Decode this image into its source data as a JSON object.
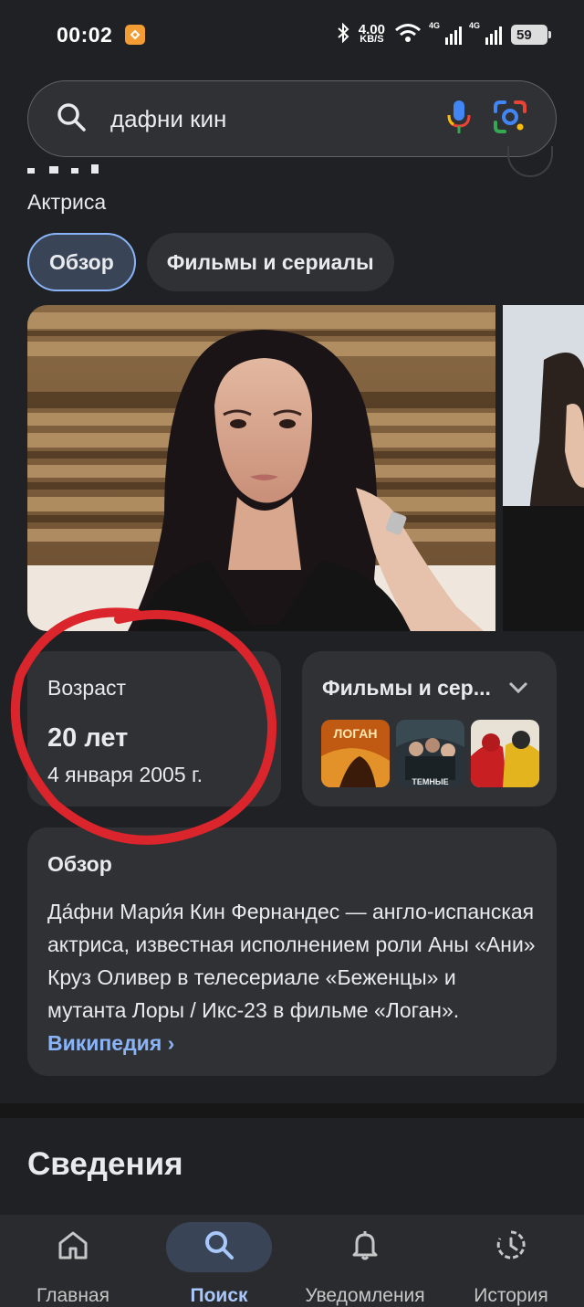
{
  "status": {
    "time": "00:02",
    "speed_value": "4.00",
    "speed_unit": "KB/S",
    "signal1": "4G",
    "signal2": "4G",
    "battery": "59"
  },
  "search": {
    "query": "дафни кин"
  },
  "header": {
    "subtitle": "Актриса"
  },
  "tabs": [
    {
      "label": "Обзор",
      "active": true
    },
    {
      "label": "Фильмы и сериалы",
      "active": false
    }
  ],
  "age_card": {
    "label": "Возраст",
    "value": "20 лет",
    "birth_date": "4 января 2005 г."
  },
  "films_card": {
    "title": "Фильмы и сер...",
    "poster1_text": "ЛОГАН",
    "poster2_text": "ТЕМНЫЕ"
  },
  "overview": {
    "title": "Обзор",
    "text": "Да́фни Мари́я Кин Фернандес — англо-испанская актриса, известная исполнением роли Аны «Ани» Круз Оливер в телесериале «Беженцы» и мутанта Лоры / Икс-23 в фильме «Логан». ",
    "link": "Википедия ›"
  },
  "details": {
    "title": "Сведения"
  },
  "bottom_nav": [
    {
      "label": "Главная",
      "icon": "home-icon"
    },
    {
      "label": "Поиск",
      "icon": "search-icon",
      "active": true
    },
    {
      "label": "Уведомления",
      "icon": "bell-icon"
    },
    {
      "label": "История",
      "icon": "history-icon"
    }
  ],
  "colors": {
    "background": "#202124",
    "card": "#303134",
    "accent": "#8ab4f8",
    "annotation": "#d9252b"
  }
}
